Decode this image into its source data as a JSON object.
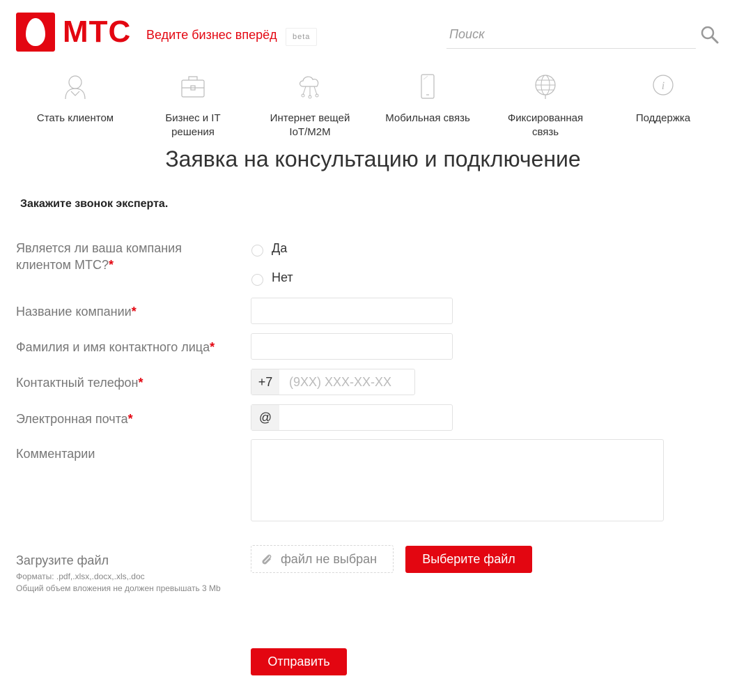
{
  "header": {
    "brand": "МТС",
    "tagline": "Ведите бизнес вперёд",
    "beta": "beta",
    "search_placeholder": "Поиск"
  },
  "nav": [
    {
      "label": "Стать клиентом",
      "icon": "person-icon"
    },
    {
      "label": "Бизнес и IT решения",
      "icon": "briefcase-icon"
    },
    {
      "label": "Интернет вещей IoT/M2M",
      "icon": "cloud-network-icon"
    },
    {
      "label": "Мобильная связь",
      "icon": "phone-icon"
    },
    {
      "label": "Фиксированная связь",
      "icon": "globe-icon"
    },
    {
      "label": "Поддержка",
      "icon": "info-icon"
    }
  ],
  "form": {
    "title": "Заявка на консультацию и подключение",
    "subtitle": "Закажите звонок эксперта.",
    "is_client_label": "Является ли ваша компания клиентом МТС?",
    "radio_yes": "Да",
    "radio_no": "Нет",
    "company_label": "Название компании",
    "contact_name_label": "Фамилия и имя контактного лица",
    "phone_label": "Контактный телефон",
    "phone_prefix": "+7",
    "phone_placeholder": "(9XX) XXX-XX-XX",
    "email_label": "Электронная почта",
    "email_prefix": "@",
    "comments_label": "Комментарии",
    "upload_label": "Загрузите файл",
    "upload_formats": "Форматы: .pdf,.xlsx,.docx,.xls,.doc",
    "upload_limit": "Общий объем вложения не должен превышать 3 Mb",
    "file_status": "файл не выбран",
    "choose_file_button": "Выберите файл",
    "submit_button": "Отправить",
    "required_mark": "*"
  },
  "colors": {
    "brand_red": "#e30611"
  }
}
